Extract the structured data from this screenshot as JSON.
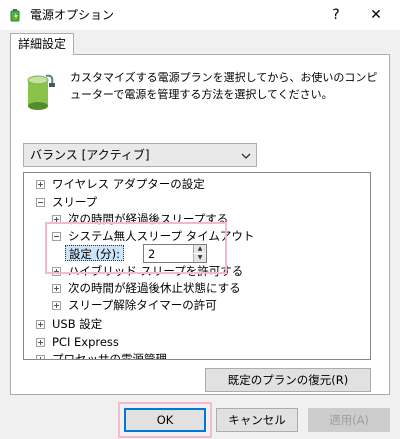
{
  "window": {
    "title": "電源オプション",
    "help_glyph": "?",
    "close_glyph": "✕"
  },
  "tab": {
    "label": "詳細設定"
  },
  "description": "カスタマイズする電源プランを選択してから、お使いのコンピューターで電源を管理する方法を選択してください。",
  "plan_select": {
    "selected": "バランス [アクティブ]"
  },
  "tree": {
    "items": [
      {
        "label": "ワイヤレス アダプターの設定",
        "state": "collapsed"
      },
      {
        "label": "スリープ",
        "state": "expanded"
      },
      {
        "label": "次の時間が経過後スリープする",
        "state": "collapsed"
      },
      {
        "label": "システム無人スリープ タイムアウト",
        "state": "expanded"
      },
      {
        "label": "ハイブリッド スリープを許可する",
        "state": "collapsed"
      },
      {
        "label": "次の時間が経過後休止状態にする",
        "state": "collapsed"
      },
      {
        "label": "スリープ解除タイマーの許可",
        "state": "collapsed"
      },
      {
        "label": "USB 設定",
        "state": "collapsed"
      },
      {
        "label": "PCI Express",
        "state": "collapsed"
      },
      {
        "label": "プロセッサの電源管理",
        "state": "collapsed"
      }
    ],
    "setting": {
      "label": "設定 (分):",
      "value": "2"
    }
  },
  "buttons": {
    "restore": "既定のプランの復元(R)",
    "ok": "OK",
    "cancel": "キャンセル",
    "apply": "適用(A)"
  },
  "colors": {
    "accent": "#0078d7",
    "highlight_outline": "#f4b8d0",
    "selection": "#cce4f7"
  }
}
